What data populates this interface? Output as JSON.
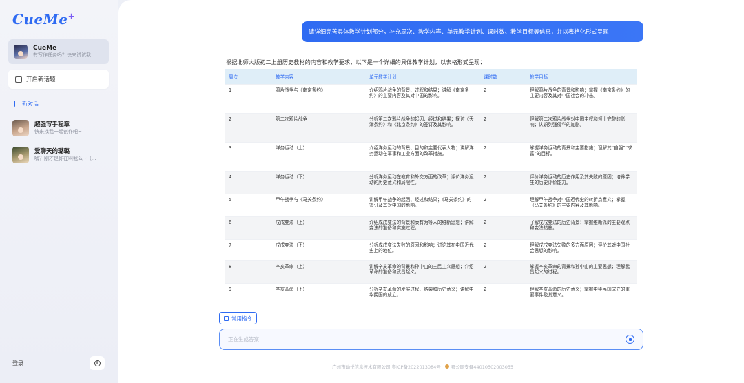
{
  "sidebar": {
    "logo": "CueMe",
    "logo_plus": "+",
    "profile": {
      "name": "CueMe",
      "subtitle": "有写作任务吗？快来试试我..."
    },
    "new_topic_label": "开启新话题",
    "new_conversation_label": "新对话",
    "chats": [
      {
        "name": "超强写手程章",
        "subtitle": "快来找我一起创作吧~"
      },
      {
        "name": "爱聊天的璐璐",
        "subtitle": "嗨？刚才是你在叫我么~（..."
      }
    ],
    "login_label": "登录",
    "info_icon": "info-icon"
  },
  "main": {
    "user_message": "请详细完善具体教学计划部分，补充周次、教学内容、单元教学计划、课时数、教学目标等信息，并以表格化形式呈现",
    "intro": "根据北师大版初二上册历史教材的内容和教学要求，以下是一个详细的具体教学计划，以表格形式呈现：",
    "table": {
      "headers": [
        "周次",
        "教学内容",
        "单元教学计划",
        "课时数",
        "教学目标"
      ],
      "rows": [
        [
          "1",
          "鸦片战争与《南京条约》",
          "介绍鸦片战争的背景、过程和结果；讲解《南京条约》的主要内容及其对中国的影响。",
          "2",
          "理解鸦片战争的背景和影响；掌握《南京条约》的主要内容及其对中国社会的冲击。"
        ],
        [
          "2",
          "第二次鸦片战争",
          "分析第二次鸦片战争的起因、经过和结果；探讨《天津条约》和《北京条约》的签订及其影响。",
          "2",
          "理解第二次鸦片战争对中国主权和领土完整的影响；认识列强侵华的加剧。"
        ],
        [
          "3",
          "洋务运动（上）",
          "介绍洋务运动的背景、目的和主要代表人物；讲解洋务运动在军事和工业方面的改革措施。",
          "2",
          "掌握洋务运动的背景和主要措施；理解其“自强”“求富”的目标。"
        ],
        [
          "4",
          "洋务运动（下）",
          "分析洋务运动在教育和外交方面的改革；评价洋务运动的历史意义和局限性。",
          "2",
          "评价洋务运动的历史作用及其失败的原因；培养学生的历史评价能力。"
        ],
        [
          "5",
          "甲午战争与《马关条约》",
          "讲解甲午战争的起因、经过和结果；《马关条约》的签订及其对中国的影响。",
          "2",
          "理解甲午战争对中国近代史的转折点意义；掌握《马关条约》的主要内容及其影响。"
        ],
        [
          "6",
          "戊戌变法（上）",
          "介绍戊戌变法的背景和康有为等人的维新思想；讲解变法的准备和实施过程。",
          "2",
          "了解戊戌变法的历史背景；掌握维新派的主要观点和变法措施。"
        ],
        [
          "7",
          "戊戌变法（下）",
          "分析戊戌变法失败的原因和影响；讨论其在中国近代史上的地位。",
          "2",
          "理解戊戌变法失败的多方面原因；评价其对中国社会思想的影响。"
        ],
        [
          "8",
          "辛亥革命（上）",
          "讲解辛亥革命的背景和孙中山的三民主义思想；介绍革命的准备和武昌起义。",
          "2",
          "掌握辛亥革命的背景和孙中山的主要思想；理解武昌起义的过程。"
        ],
        [
          "9",
          "辛亥革命（下）",
          "分析辛亥革命的发展过程、结果和历史意义；讲解中华民国的成立。",
          "2",
          "理解辛亥革命的历史意义；掌握中华民国成立的重要事件及其意义。"
        ]
      ]
    },
    "tool_chip_label": "常用指令",
    "input_placeholder": "正在生成答案",
    "footer": {
      "company": "广州市动悦信息技术有限公司 粤ICP备2022013084号",
      "police": "粤公网安备44010502003055"
    }
  },
  "colors": {
    "accent": "#2f6bf2",
    "table_header_bg": "#dfeef8"
  }
}
